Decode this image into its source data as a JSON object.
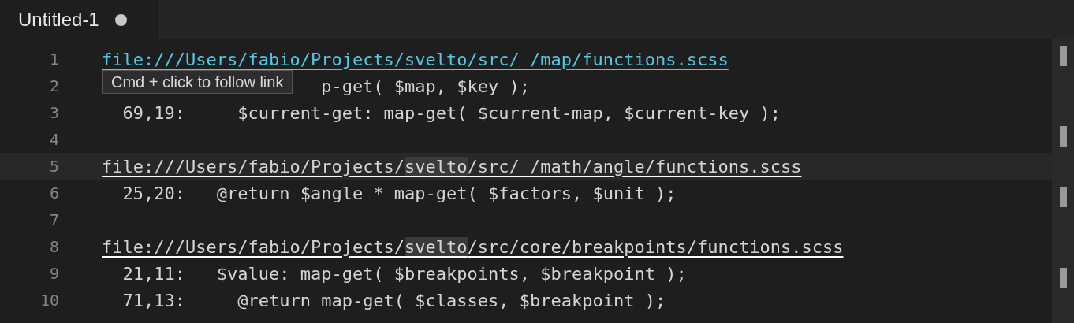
{
  "tabs": [
    {
      "label": "Untitled-1",
      "selected": true,
      "dirty": true
    }
  ],
  "editor": {
    "lines": [
      {
        "number": "1",
        "kind": "link",
        "current": false,
        "hovered": true,
        "parts": [
          {
            "text": "file:///Users/fabio/Projects/svelto/src/_/map/functions.scss",
            "highlighted": false
          }
        ]
      },
      {
        "number": "2",
        "kind": "partial",
        "current": false,
        "text": "p-get( $map, $key );"
      },
      {
        "number": "3",
        "kind": "match",
        "current": false,
        "text": "  69,19:     $current-get: map-get( $current-map, $current-key );"
      },
      {
        "number": "4",
        "kind": "blank",
        "current": false
      },
      {
        "number": "5",
        "kind": "link",
        "current": true,
        "hovered": false,
        "parts": [
          {
            "text": "file:///Users/fabio/Projects/",
            "highlighted": false
          },
          {
            "text": "svelto",
            "highlighted": true
          },
          {
            "text": "/src/_/math/angle/functions.scss",
            "highlighted": false
          }
        ]
      },
      {
        "number": "6",
        "kind": "match",
        "current": false,
        "text": "  25,20:   @return $angle * map-get( $factors, $unit );"
      },
      {
        "number": "7",
        "kind": "blank",
        "current": false
      },
      {
        "number": "8",
        "kind": "link",
        "current": false,
        "hovered": false,
        "parts": [
          {
            "text": "file:///Users/fabio/Projects/",
            "highlighted": false
          },
          {
            "text": "svelto",
            "highlighted": true
          },
          {
            "text": "/src/core/breakpoints/functions.scss",
            "highlighted": false
          }
        ]
      },
      {
        "number": "9",
        "kind": "match",
        "current": false,
        "text": "  21,11:   $value: map-get( $breakpoints, $breakpoint );"
      },
      {
        "number": "10",
        "kind": "match",
        "current": false,
        "text": "  71,13:     @return map-get( $classes, $breakpoint );"
      }
    ]
  },
  "tooltip": {
    "text": "Cmd + click to follow link"
  }
}
